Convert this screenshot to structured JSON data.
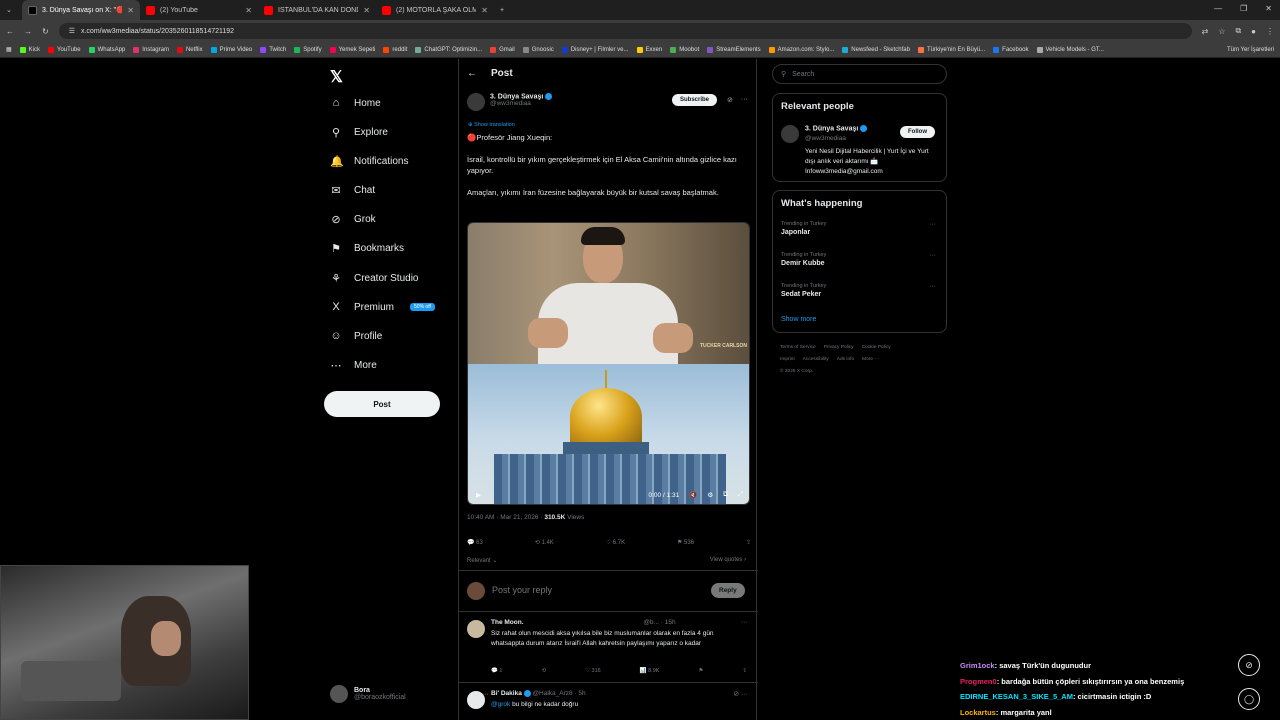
{
  "tabs": [
    {
      "label": "3. Dünya Savaşı on X: \"🔴 Profe",
      "active": true,
      "color": "#ffffff"
    },
    {
      "label": "(2) YouTube",
      "active": false,
      "color": "#ff0000"
    },
    {
      "label": "İSTANBUL'DA KAN DONDURAN",
      "active": false,
      "color": "#ff0000"
    },
    {
      "label": "(2) MOTORLA ŞAKA OLMAZ | S",
      "active": false,
      "color": "#ff0000"
    }
  ],
  "address": {
    "url": "x.com/ww3mediaa/status/2035260118514721192"
  },
  "bookmarks": [
    "Kick",
    "YouTube",
    "WhatsApp",
    "Instagram",
    "Netflix",
    "Prime Video",
    "Twitch",
    "Spotify",
    "Yemek Sepeti",
    "reddit",
    "ChatGPT: Optimizin...",
    "Gmail",
    "Gnoosic",
    "Disney+ | Filmler ve...",
    "Exxen",
    "Moobot",
    "StreamElements",
    "Amazon.com: Stylo...",
    "Newsfeed - Sketchfab",
    "Türkiye'nin En Büyü...",
    "Facebook",
    "Vehicle Models - GT..."
  ],
  "bookmarks_all": "Tüm Yer İşaretleri",
  "nav": {
    "items": [
      {
        "label": "Home",
        "icon": "home-icon",
        "glyph": "⌂"
      },
      {
        "label": "Explore",
        "icon": "search-icon",
        "glyph": "⚲"
      },
      {
        "label": "Notifications",
        "icon": "bell-icon",
        "glyph": "🔔"
      },
      {
        "label": "Chat",
        "icon": "mail-icon",
        "glyph": "✉"
      },
      {
        "label": "Grok",
        "icon": "grok-icon",
        "glyph": "⊘"
      },
      {
        "label": "Bookmarks",
        "icon": "bookmark-icon",
        "glyph": "⚑"
      },
      {
        "label": "Creator Studio",
        "icon": "creator-studio-icon",
        "glyph": "⚘"
      },
      {
        "label": "Premium",
        "icon": "x-premium-icon",
        "glyph": "X"
      },
      {
        "label": "Profile",
        "icon": "profile-icon",
        "glyph": "☺"
      },
      {
        "label": "More",
        "icon": "more-icon",
        "glyph": "⋯"
      }
    ],
    "premium_badge": "50% off",
    "post_button": "Post",
    "account": {
      "name": "Bora",
      "handle": "@boraozkofficial"
    }
  },
  "post": {
    "header_title": "Post",
    "author_name": "3. Dünya Savaşı",
    "author_handle": "@ww3mediaa",
    "subscribe_label": "Subscribe",
    "show_translation": "Show translation",
    "paragraphs": [
      "🔴Profesör Jiang Xueqin:",
      "İsrail, kontrollü bir yıkım gerçekleştirmek için El Aksa Camii'nin altında gizlice kazı yapıyor.",
      "Amaçları, yıkımı İran füzesine bağlayarak büyük bir kutsal savaş başlatmak."
    ],
    "video_time": "0:00 / 1:31",
    "video_watermark": "TUCKER CARLSON",
    "timestamp": "10:40 AM · Mar 21, 2026 · ",
    "views_count": "310.5K",
    "views_label": " Views",
    "stats": {
      "replies": "63",
      "reposts": "1.4K",
      "likes": "6.7K",
      "bookmarks": "536"
    },
    "sort_label": "Relevant",
    "view_quotes": "View quotes",
    "reply_placeholder": "Post your reply",
    "reply_button": "Reply"
  },
  "comments": [
    {
      "name": "The Moon.",
      "handle": "@b...",
      "time": "· 15h",
      "text": "Siz rahat olun mescidi aksa yıkılsa bile biz muslumanlar olarak en fazla 4 gün whatsappta durum atarız İsrail'i Allah kahretsin paylaşımı yaparız o kadar",
      "replies": "1",
      "reposts": "",
      "likes": "316",
      "views": "8.9K"
    },
    {
      "name": "Bi' Dakika",
      "handle": "@Halka_Arz8",
      "time": "· 5h",
      "text": "bu bilgi ne kadar doğru",
      "mention": "@grok"
    }
  ],
  "right": {
    "search_placeholder": "Search",
    "relevant_title": "Relevant people",
    "person": {
      "name": "3. Dünya Savaşı",
      "handle": "@ww3mediaa",
      "follow": "Follow",
      "bio": "Yeni Nesil Dijital Habercilik | Yurt İçi ve Yurt dışı anlık veri aktarımı 📩 Infoww3media@gmail.com"
    },
    "happening_title": "What's happening",
    "trends": [
      {
        "context": "Trending in Turkey",
        "topic": "Japonlar"
      },
      {
        "context": "Trending in Turkey",
        "topic": "Demir Kubbe"
      },
      {
        "context": "Trending in Turkey",
        "topic": "Sedat Peker"
      }
    ],
    "show_more": "Show more",
    "footer": [
      "Terms of Service",
      "Privacy Policy",
      "Cookie Policy",
      "Imprint",
      "Accessibility",
      "Ads info",
      "More ···",
      "© 2026 X Corp."
    ]
  },
  "chat": [
    {
      "user": "Grim1ock",
      "msg": ": savaş Türk'ün dugunudur"
    },
    {
      "user": "Progmen0",
      "msg": ": bardağa bütün çöpleri sıkıştırırsın ya ona benzemiş"
    },
    {
      "user": "EDIRNE_KESAN_3_SIKE_5_AM",
      "msg": ": cicirtmasin ictigin :D"
    },
    {
      "user": "Lockartus",
      "msg": ": margarita yanl"
    }
  ]
}
